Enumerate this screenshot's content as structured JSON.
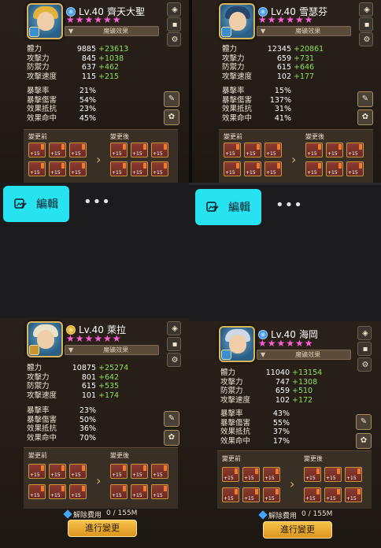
{
  "common": {
    "rune_effect_label": "魔礦效果",
    "before_label": "變更前",
    "after_label": "變更後",
    "fee_label": "解除費用",
    "fee_value": "0 / 155M",
    "change_button": "進行變更",
    "edit_label": "編輯",
    "more_label": "•••",
    "stat_labels": [
      "體力",
      "攻擊力",
      "防禦力",
      "攻擊速度"
    ],
    "sec_labels": [
      "暴擊率",
      "暴擊傷害",
      "效果抵抗",
      "效果命中"
    ],
    "stars": "★★★★★★"
  },
  "cards": [
    {
      "level": "Lv.40",
      "name": "齊天大聖",
      "element": "water",
      "stats": [
        [
          "9885",
          "+23613"
        ],
        [
          "845",
          "+1038"
        ],
        [
          "637",
          "+462"
        ],
        [
          "115",
          "+215"
        ]
      ],
      "secondary": [
        "21%",
        "54%",
        "23%",
        "45%"
      ]
    },
    {
      "level": "Lv.40",
      "name": "雪瑟芬",
      "element": "water",
      "stats": [
        [
          "12345",
          "+20861"
        ],
        [
          "659",
          "+731"
        ],
        [
          "615",
          "+646"
        ],
        [
          "102",
          "+177"
        ]
      ],
      "secondary": [
        "15%",
        "137%",
        "31%",
        "41%"
      ]
    },
    {
      "level": "Lv.40",
      "name": "萊拉",
      "element": "fire",
      "stats": [
        [
          "10875",
          "+25274"
        ],
        [
          "801",
          "+642"
        ],
        [
          "615",
          "+535"
        ],
        [
          "101",
          "+174"
        ]
      ],
      "secondary": [
        "23%",
        "50%",
        "36%",
        "70%"
      ]
    },
    {
      "level": "Lv.40",
      "name": "海岡",
      "element": "water",
      "stats": [
        [
          "11040",
          "+13154"
        ],
        [
          "747",
          "+1308"
        ],
        [
          "659",
          "+510"
        ],
        [
          "102",
          "+172"
        ]
      ],
      "secondary": [
        "43%",
        "55%",
        "37%",
        "17%"
      ]
    }
  ],
  "colors": {
    "accent_button": "#27e2ef",
    "star_color": "#ff5fd6",
    "bonus_green": "#8fe05a",
    "gold_button": "#f0b233"
  }
}
